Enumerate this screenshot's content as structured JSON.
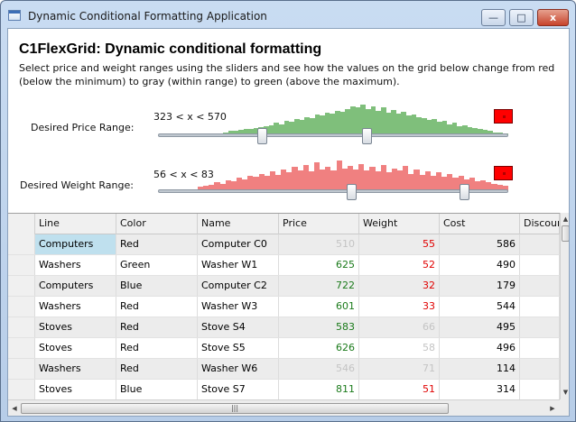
{
  "window": {
    "title": "Dynamic Conditional Formatting Application",
    "minimize_label": "—",
    "maximize_label": "□",
    "close_label": "x"
  },
  "header": {
    "title": "C1FlexGrid: Dynamic conditional formatting",
    "description": "Select price and weight ranges using the sliders and see how the values on the grid below change from red (below the minimum) to gray (within range) to green (above the maximum)."
  },
  "price_range": {
    "label": "Desired Price Range:",
    "range_text": "323 < x < 570",
    "min": 323,
    "max": 570,
    "color": "#7fbf7b",
    "swatch_color": "#ff0000",
    "histogram": [
      3,
      4,
      4,
      5,
      6,
      6,
      7,
      8,
      9,
      10,
      12,
      11,
      14,
      13,
      16,
      15,
      18,
      17,
      20,
      19,
      22,
      21,
      24,
      23,
      26,
      28,
      27,
      30,
      26,
      28,
      24,
      27,
      22,
      25,
      21,
      23,
      19,
      20,
      18,
      17,
      15,
      16,
      13,
      14,
      11,
      12,
      9,
      10,
      8,
      7,
      6,
      5,
      4,
      3,
      3,
      2
    ]
  },
  "weight_range": {
    "label": "Desired Weight Range:",
    "range_text": "56 < x < 83",
    "min": 56,
    "max": 83,
    "color": "#f08080",
    "swatch_color": "#ff0000",
    "histogram": [
      4,
      5,
      6,
      8,
      7,
      10,
      9,
      12,
      11,
      14,
      13,
      16,
      14,
      18,
      15,
      20,
      17,
      22,
      19,
      24,
      18,
      26,
      20,
      22,
      19,
      28,
      21,
      23,
      20,
      25,
      19,
      22,
      18,
      24,
      17,
      21,
      19,
      23,
      16,
      20,
      15,
      18,
      14,
      17,
      13,
      16,
      12,
      14,
      11,
      12,
      9,
      10,
      8,
      7,
      6,
      5
    ]
  },
  "grid": {
    "columns": [
      "Line",
      "Color",
      "Name",
      "Price",
      "Weight",
      "Cost",
      "Discount"
    ],
    "rows": [
      {
        "line": "Computers",
        "color": "Red",
        "name": "Computer C0",
        "price": "510",
        "price_state": "in",
        "weight": "55",
        "weight_state": "lo",
        "cost": "586"
      },
      {
        "line": "Washers",
        "color": "Green",
        "name": "Washer W1",
        "price": "625",
        "price_state": "hi",
        "weight": "52",
        "weight_state": "lo",
        "cost": "490"
      },
      {
        "line": "Computers",
        "color": "Blue",
        "name": "Computer C2",
        "price": "722",
        "price_state": "hi",
        "weight": "32",
        "weight_state": "lo",
        "cost": "179"
      },
      {
        "line": "Washers",
        "color": "Red",
        "name": "Washer W3",
        "price": "601",
        "price_state": "hi",
        "weight": "33",
        "weight_state": "lo",
        "cost": "544"
      },
      {
        "line": "Stoves",
        "color": "Red",
        "name": "Stove S4",
        "price": "583",
        "price_state": "hi",
        "weight": "66",
        "weight_state": "in",
        "cost": "495"
      },
      {
        "line": "Stoves",
        "color": "Red",
        "name": "Stove S5",
        "price": "626",
        "price_state": "hi",
        "weight": "58",
        "weight_state": "in",
        "cost": "496"
      },
      {
        "line": "Washers",
        "color": "Red",
        "name": "Washer W6",
        "price": "546",
        "price_state": "in",
        "weight": "71",
        "weight_state": "in",
        "cost": "114"
      },
      {
        "line": "Stoves",
        "color": "Blue",
        "name": "Stove S7",
        "price": "811",
        "price_state": "hi",
        "weight": "51",
        "weight_state": "lo",
        "cost": "314"
      }
    ],
    "state_colors": {
      "lo": "#e00000",
      "in": "#c4c4c4",
      "hi": "#1a7a1a"
    }
  },
  "scroll": {
    "up_arrow": "▲",
    "down_arrow": "▼",
    "left_arrow": "◀",
    "right_arrow": "▶",
    "grip": "|||"
  }
}
